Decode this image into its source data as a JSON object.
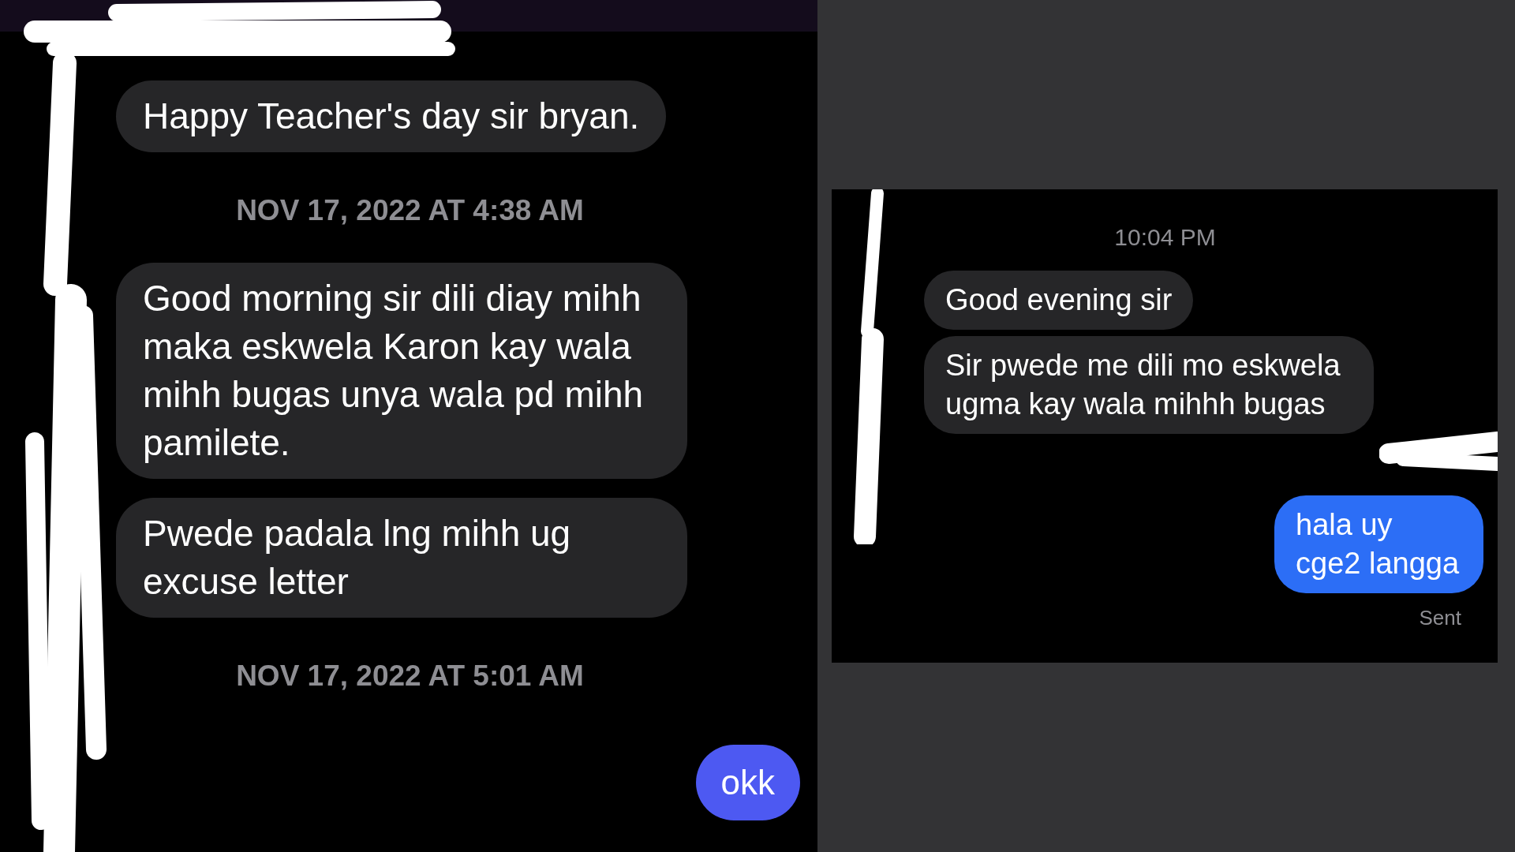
{
  "left_chat": {
    "messages": [
      {
        "kind": "received",
        "text": "Happy Teacher's day sir bryan."
      },
      {
        "kind": "timestamp",
        "text": "NOV 17, 2022 AT 4:38 AM"
      },
      {
        "kind": "received",
        "text": "Good morning sir dili diay mihh maka eskwela Karon kay wala mihh bugas unya wala pd mihh pamilete."
      },
      {
        "kind": "received",
        "text": "Pwede padala lng mihh ug excuse letter"
      },
      {
        "kind": "timestamp",
        "text": "NOV 17, 2022 AT 5:01 AM"
      },
      {
        "kind": "sent",
        "text": "okk"
      }
    ]
  },
  "right_chat": {
    "messages": [
      {
        "kind": "timestamp",
        "text": "10:04 PM"
      },
      {
        "kind": "received",
        "text": "Good evening sir"
      },
      {
        "kind": "received",
        "text": "Sir pwede me dili mo eskwela ugma kay wala mihhh bugas"
      },
      {
        "kind": "sent",
        "text": "hala uy cge2 langga"
      },
      {
        "kind": "status",
        "text": "Sent"
      }
    ]
  }
}
